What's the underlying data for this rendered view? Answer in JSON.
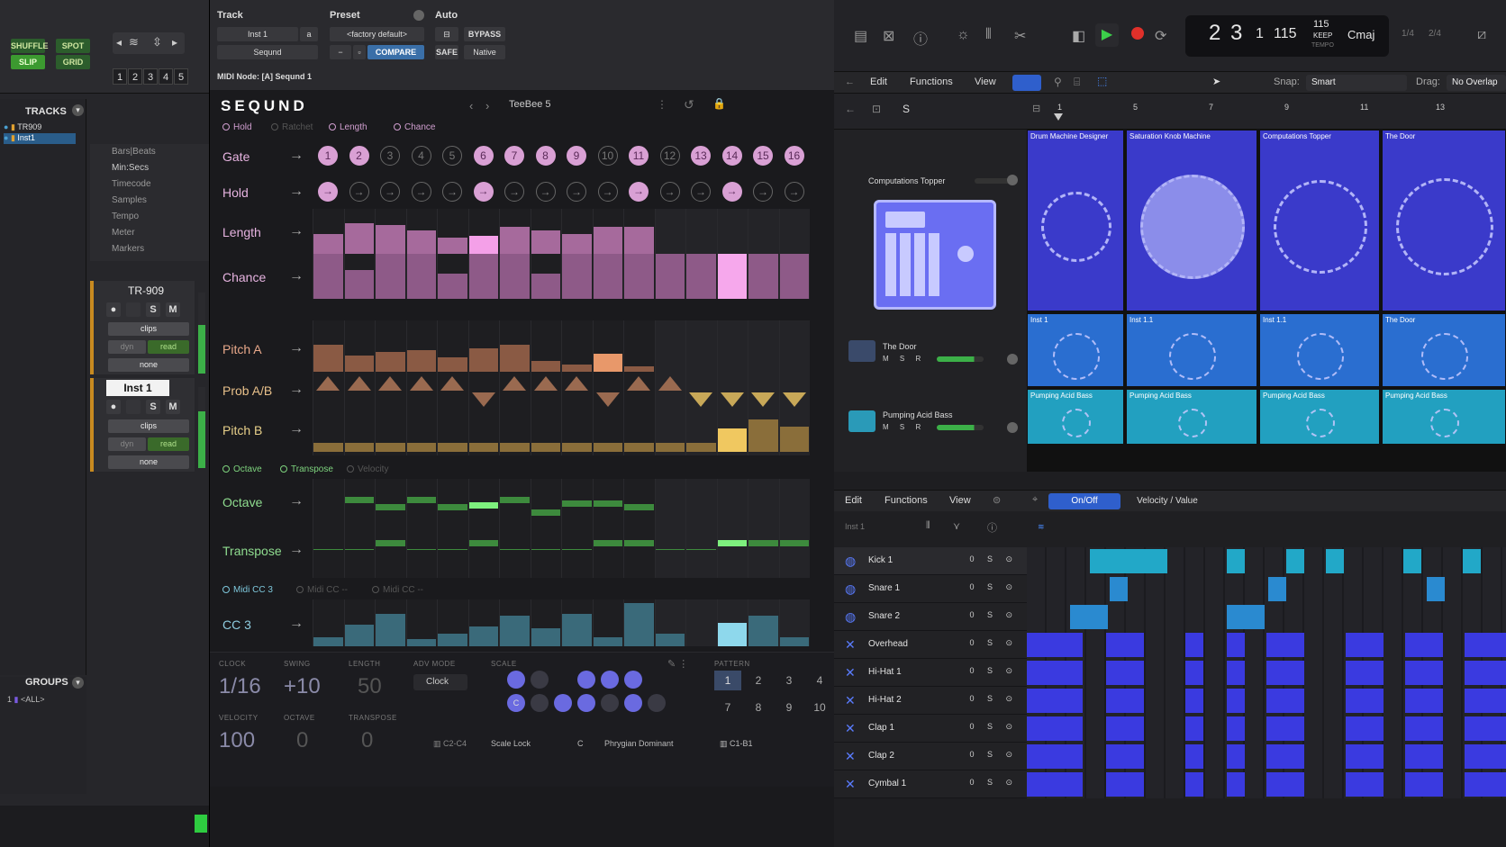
{
  "protools": {
    "modes": {
      "shuffle": "SHUFFLE",
      "spot": "SPOT",
      "slip": "SLIP",
      "grid": "GRID"
    },
    "numbers": [
      "1",
      "2",
      "3",
      "4",
      "5"
    ],
    "tracks_title": "TRACKS",
    "track_list": [
      "TR909",
      "Inst1"
    ],
    "timeline": [
      "Bars|Beats",
      "Min:Secs",
      "Timecode",
      "Samples",
      "Tempo",
      "Meter",
      "Markers"
    ],
    "channel1": {
      "name": "TR-909",
      "s": "S",
      "m": "M",
      "clips": "clips",
      "dyn": "dyn",
      "read": "read",
      "none": "none"
    },
    "channel2": {
      "name": "Inst 1",
      "s": "S",
      "m": "M",
      "clips": "clips",
      "dyn": "dyn",
      "read": "read",
      "none": "none"
    },
    "groups_title": "GROUPS",
    "groups_all": "<ALL>",
    "groups_num": "1"
  },
  "seqund": {
    "header": {
      "track_label": "Track",
      "preset_label": "Preset",
      "auto_label": "Auto",
      "track_value": "Inst 1",
      "track_suffix": "a",
      "plugin_value": "Seqund",
      "preset_value": "<factory default>",
      "bypass": "BYPASS",
      "compare": "COMPARE",
      "safe": "SAFE",
      "native": "Native",
      "midi_node": "MIDI Node: [A] Seqund 1"
    },
    "logo": "SEQUND",
    "preset_name": "TeeBee 5",
    "tags1": {
      "hold": "Hold",
      "ratchet": "Ratchet",
      "length": "Length",
      "chance": "Chance"
    },
    "rows": {
      "gate": "Gate",
      "hold": "Hold",
      "length": "Length",
      "chance": "Chance",
      "pitch_a": "Pitch A",
      "prob": "Prob A/B",
      "pitch_b": "Pitch B",
      "octave": "Octave",
      "transpose": "Transpose",
      "cc3": "CC 3"
    },
    "gate_steps": [
      "1",
      "2",
      "3",
      "4",
      "5",
      "6",
      "7",
      "8",
      "9",
      "10",
      "11",
      "12",
      "13",
      "14",
      "15",
      "16"
    ],
    "tags2": {
      "octave": "Octave",
      "transpose": "Transpose",
      "velocity": "Velocity"
    },
    "tags3": {
      "midi_cc3": "Midi CC 3",
      "midi_cc_a": "Midi CC --",
      "midi_cc_b": "Midi CC --"
    },
    "bottom": {
      "clock_label": "CLOCK",
      "clock": "1/16",
      "swing_label": "SWING",
      "swing": "+10",
      "length_label": "LENGTH",
      "length": "50",
      "adv_label": "ADV MODE",
      "adv": "Clock",
      "scale_label": "SCALE",
      "velocity_label": "VELOCITY",
      "velocity": "100",
      "octave_label": "OCTAVE",
      "octave": "0",
      "transpose_label": "TRANSPOSE",
      "transpose": "0",
      "range": "C2-C4",
      "scale_lock": "Scale Lock",
      "root": "C",
      "scale_c": "C",
      "mode": "Phrygian Dominant",
      "pattern_label": "PATTERN",
      "patterns": [
        "1",
        "2",
        "3",
        "4",
        "7",
        "8",
        "9",
        "10"
      ],
      "pattern_range": "C1-B1"
    }
  },
  "logic": {
    "lcd": {
      "bar": "2",
      "beat": "3",
      "div": "1",
      "tick": "115",
      "tempo": "115",
      "keep": "KEEP",
      "tempo_lbl": "TEMPO",
      "key": "Cmaj",
      "sig1": "1/4",
      "sig2": "2/4"
    },
    "menu": {
      "edit": "Edit",
      "functions": "Functions",
      "view": "View",
      "snap_label": "Snap:",
      "snap": "Smart",
      "drag_label": "Drag:",
      "drag": "No Overlap"
    },
    "ruler": [
      "1",
      "5",
      "7",
      "9",
      "11",
      "13"
    ],
    "s_button": "S",
    "cells_row1": [
      "Drum Machine Designer",
      "Saturation Knob Machine",
      "Computations Topper",
      "The Door"
    ],
    "cells_row2": [
      "Inst 1",
      "Inst 1.1",
      "Inst 1.1",
      "The Door"
    ],
    "cells_row3": [
      "Pumping Acid Bass",
      "Pumping Acid Bass",
      "Pumping Acid Bass",
      "Pumping Acid Bass"
    ],
    "tracks_top": {
      "t1": "Computations Topper",
      "t2": "The Door",
      "t3": "Pumping Acid Bass"
    },
    "msr": "M S R",
    "bottom_menu": {
      "edit": "Edit",
      "functions": "Functions",
      "view": "View",
      "onoff": "On/Off",
      "velocity": "Velocity / Value"
    },
    "inst": "Inst 1",
    "drum_tracks": [
      "Kick 1",
      "Snare 1",
      "Snare 2",
      "Overhead",
      "Hi-Hat 1",
      "Hi-Hat 2",
      "Clap 1",
      "Clap 2",
      "Cymbal 1"
    ],
    "drum_btns": "0 S ⊙"
  }
}
